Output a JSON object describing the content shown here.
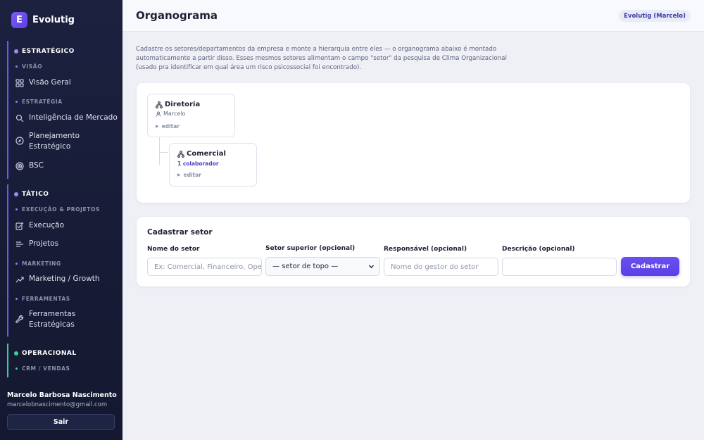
{
  "brand": {
    "logo_letter": "E",
    "name": "Evolutig"
  },
  "sidebar": {
    "sections": [
      {
        "title": "ESTRATÉGICO",
        "groups": [
          {
            "title": "VISÃO",
            "items": [
              {
                "label": "Visão Geral",
                "icon": "grid-icon"
              }
            ]
          },
          {
            "title": "ESTRATÉGIA",
            "items": [
              {
                "label": "Inteligência de Mercado",
                "icon": "search-icon"
              },
              {
                "label": "Planejamento Estratégico",
                "icon": "compass-icon"
              },
              {
                "label": "BSC",
                "icon": "target-icon"
              }
            ]
          }
        ]
      },
      {
        "title": "TÁTICO",
        "groups": [
          {
            "title": "EXECUÇÃO & PROJETOS",
            "items": [
              {
                "label": "Execução",
                "icon": "checkbox-edit-icon"
              },
              {
                "label": "Projetos",
                "icon": "list-icon"
              }
            ]
          },
          {
            "title": "MARKETING",
            "items": [
              {
                "label": "Marketing / Growth",
                "icon": "trending-up-icon"
              }
            ]
          },
          {
            "title": "FERRAMENTAS",
            "items": [
              {
                "label": "Ferramentas Estratégicas",
                "icon": "wrench-icon"
              }
            ]
          }
        ]
      },
      {
        "title": "OPERACIONAL",
        "groups": [
          {
            "title": "CRM / VENDAS",
            "items": []
          }
        ]
      }
    ],
    "user": {
      "name": "Marcelo Barbosa Nascimento",
      "email": "marcelobnascimento@gmail.com"
    },
    "logout_label": "Sair"
  },
  "header": {
    "title": "Organograma",
    "org_badge": "Evolutig (Marcelo)"
  },
  "intro_text": "Cadastre os setores/departamentos da empresa e monte a hierarquia entre eles — o organograma abaixo é montado automaticamente a partir disso. Esses mesmos setores alimentam o campo \"setor\" da pesquisa de Clima Organizacional (usado pra identificar em qual área um risco psicossocial foi encontrado).",
  "org_chart": {
    "nodes": [
      {
        "name": "Diretoria",
        "manager": "Marcelo",
        "edit_label": "editar"
      },
      {
        "name": "Comercial",
        "collaborators": "1 colaborador",
        "edit_label": "editar"
      }
    ]
  },
  "form": {
    "title": "Cadastrar setor",
    "fields": {
      "name": {
        "label": "Nome do setor",
        "placeholder": "Ex: Comercial, Financeiro, Operações"
      },
      "parent": {
        "label": "Setor superior (opcional)",
        "value": "— setor de topo —"
      },
      "responsible": {
        "label": "Responsável (opcional)",
        "placeholder": "Nome do gestor do setor"
      },
      "description": {
        "label": "Descrição (opcional)",
        "placeholder": ""
      }
    },
    "submit_label": "Cadastrar"
  },
  "colors": {
    "accent": "#5a3fe3",
    "sidebar_bg": "#1c2140",
    "strategic": "#6d5ae6",
    "operational": "#34d399"
  }
}
